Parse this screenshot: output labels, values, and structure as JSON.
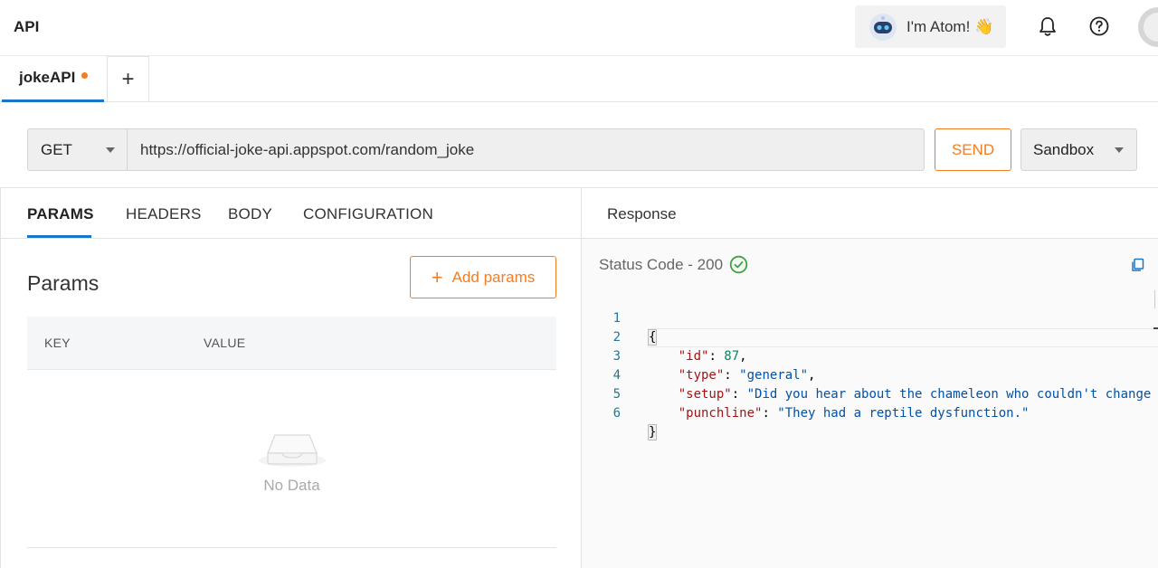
{
  "header": {
    "title": "API",
    "assistant_label": "I'm Atom! 👋",
    "icons": [
      "robot-avatar-icon",
      "bell-icon",
      "help-icon",
      "profile-avatar"
    ]
  },
  "tabs": [
    {
      "label": "jokeAPI",
      "unsaved": true,
      "active": true
    }
  ],
  "request": {
    "method": "GET",
    "url": "https://official-joke-api.appspot.com/random_joke",
    "send_label": "SEND",
    "environment": "Sandbox"
  },
  "request_tabs": [
    "PARAMS",
    "HEADERS",
    "BODY",
    "CONFIGURATION"
  ],
  "params": {
    "title": "Params",
    "add_label": "Add params",
    "columns": [
      "KEY",
      "VALUE"
    ],
    "empty_text": "No Data"
  },
  "response": {
    "tab_label": "Response",
    "status_text": "Status Code - 200",
    "line_numbers": [
      "1",
      "2",
      "3",
      "4",
      "5",
      "6"
    ],
    "body": {
      "id_key": "\"id\"",
      "id_val": "87",
      "type_key": "\"type\"",
      "type_val": "\"general\"",
      "setup_key": "\"setup\"",
      "setup_val": "\"Did you hear about the chameleon who couldn't change",
      "punchline_key": "\"punchline\"",
      "punchline_val": "\"They had a reptile dysfunction.\""
    }
  },
  "colors": {
    "accent_orange": "#f57c1f",
    "accent_blue": "#1976c9",
    "success_green": "#3aa53a"
  }
}
